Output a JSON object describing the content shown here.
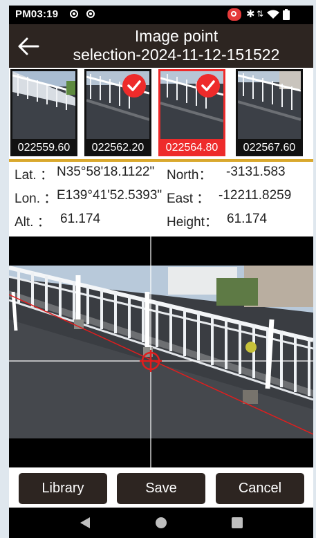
{
  "status_bar": {
    "time": "PM03:19",
    "icons": [
      "sync-icon",
      "sync-icon",
      "screen-record-icon",
      "bluetooth-icon",
      "data-arrows-icon",
      "wifi-icon",
      "battery-icon"
    ]
  },
  "header": {
    "title_line1": "Image point",
    "title_line2": "selection-2024-11-12-151522",
    "back_icon": "arrow-left-icon"
  },
  "thumbnails": [
    {
      "label": "022559.60",
      "checked": false,
      "selected": false
    },
    {
      "label": "022562.20",
      "checked": true,
      "selected": false
    },
    {
      "label": "022564.80",
      "checked": true,
      "selected": true
    },
    {
      "label": "022567.60",
      "checked": false,
      "selected": false
    }
  ],
  "coords": {
    "lat_label": "Lat. ：",
    "lat_value": "N35°58'18.1122\"",
    "lon_label": "Lon. ：",
    "lon_value": "E139°41'52.5393\"",
    "alt_label": "Alt. ：",
    "alt_value": "61.174",
    "north_label": "North：",
    "north_value": "-3131.583",
    "east_label": "East ：",
    "east_value": "-12211.8259",
    "height_label": "Height：",
    "height_value": "61.174"
  },
  "buttons": {
    "library": "Library",
    "save": "Save",
    "cancel": "Cancel"
  },
  "colors": {
    "bar": "#2d2521",
    "accent_red": "#ee2b2b",
    "divider_gold": "#d9a82d"
  }
}
